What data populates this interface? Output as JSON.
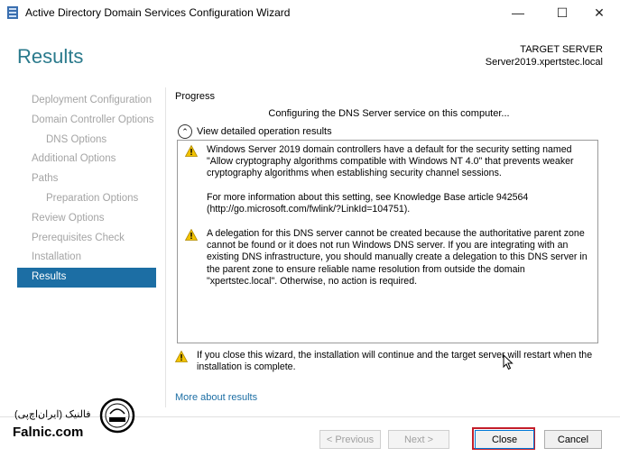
{
  "window": {
    "title": "Active Directory Domain Services Configuration Wizard",
    "controls": {
      "minimize": "—",
      "maximize": "☐",
      "close": "✕"
    }
  },
  "header": {
    "heading": "Results",
    "target_label": "TARGET SERVER",
    "target_value": "Server2019.xpertstec.local"
  },
  "sidebar": {
    "items": [
      {
        "label": "Deployment Configuration"
      },
      {
        "label": "Domain Controller Options"
      },
      {
        "label": "DNS Options"
      },
      {
        "label": "Additional Options"
      },
      {
        "label": "Paths"
      },
      {
        "label": "Preparation Options"
      },
      {
        "label": "Review Options"
      },
      {
        "label": "Prerequisites Check"
      },
      {
        "label": "Installation"
      },
      {
        "label": "Results"
      }
    ]
  },
  "main": {
    "progress_label": "Progress",
    "status": "Configuring the DNS Server service on this computer...",
    "details_toggle": "View detailed operation results",
    "toggle_icon": "⌃",
    "messages": [
      {
        "icon": "warning-icon",
        "paragraphs": [
          "Windows Server 2019 domain controllers have a default for the security setting named \"Allow cryptography algorithms compatible with Windows NT 4.0\" that prevents weaker cryptography algorithms when establishing security channel sessions.",
          "For more information about this setting, see Knowledge Base article 942564 (http://go.microsoft.com/fwlink/?LinkId=104751)."
        ]
      },
      {
        "icon": "warning-icon",
        "paragraphs": [
          "A delegation for this DNS server cannot be created because the authoritative parent zone cannot be found or it does not run Windows DNS server. If you are integrating with an existing DNS infrastructure, you should manually create a delegation to this DNS server in the parent zone to ensure reliable name resolution from outside the domain \"xpertstec.local\". Otherwise, no action is required."
        ]
      }
    ],
    "footer_warning": "If you close this wizard, the installation will continue and the target server will restart when the installation is complete.",
    "more_link": "More about results"
  },
  "footer": {
    "buttons": {
      "previous": "< Previous",
      "next": "Next >",
      "close": "Close",
      "cancel": "Cancel"
    }
  },
  "watermark": {
    "text_fa": "فالنیک (ایران‌اچ‌پی)",
    "text_en": "Falnic.com"
  },
  "colors": {
    "heading": "#2a7a8c",
    "active_nav": "#1c6ea4",
    "highlight": "#c41e2a",
    "warning": "#f2c200"
  }
}
